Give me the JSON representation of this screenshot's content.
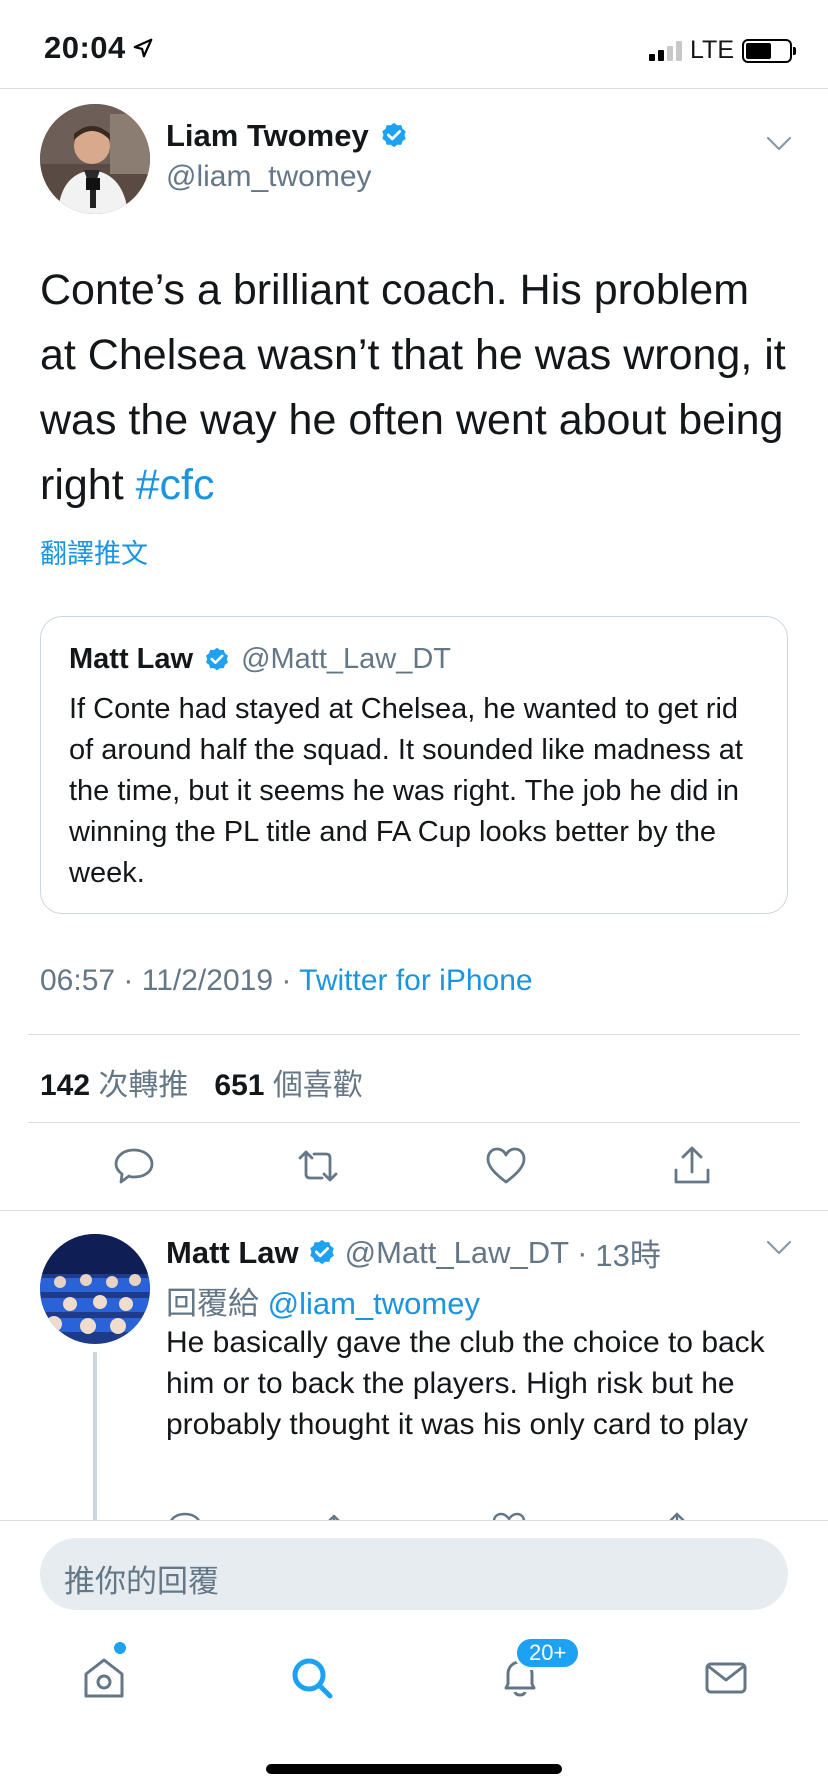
{
  "status_bar": {
    "time": "20:04",
    "network": "LTE"
  },
  "main_tweet": {
    "author_name": "Liam Twomey",
    "author_handle": "@liam_twomey",
    "text": "Conte’s a brilliant coach. His problem at Chelsea wasn’t that he was wrong, it was the way he often went about being right ",
    "hashtag": "#cfc",
    "translate_label": "翻譯推文",
    "quoted": {
      "name": "Matt Law",
      "handle": "@Matt_Law_DT",
      "text": "If Conte had stayed at Chelsea, he wanted to get rid of around half the squad. It sounded like madness at the time, but it seems he was right. The job he did in winning the PL title and FA Cup looks better by the week."
    },
    "time": "06:57",
    "date": "11/2/2019",
    "separator": "·",
    "source": "Twitter for iPhone",
    "retweet_count": "142",
    "retweet_label": "次轉推",
    "like_count": "651",
    "like_label": "個喜歡"
  },
  "reply_tweet": {
    "name": "Matt Law",
    "handle": "@Matt_Law_DT",
    "separator": "·",
    "time_ago": "13時",
    "replying_label": "回覆給",
    "replying_to": "@liam_twomey",
    "text": "He basically gave the club the choice to back him or to back the players. High risk but he probably thought it was his only card to play"
  },
  "compose": {
    "placeholder": "推你的回覆"
  },
  "tabbar": {
    "items": [
      "home-icon",
      "search-icon",
      "notifications-icon",
      "messages-icon"
    ],
    "notification_badge": "20+"
  },
  "colors": {
    "accent": "#1da1f2",
    "link": "#1b95e0",
    "muted": "#657786",
    "divider": "#d7dde2"
  }
}
